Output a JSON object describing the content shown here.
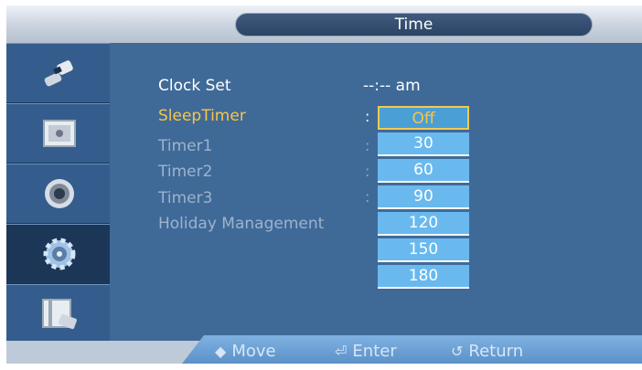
{
  "title": "Time",
  "sidebar": {
    "tabs": [
      {
        "icon": "input-plug-icon"
      },
      {
        "icon": "picture-icon"
      },
      {
        "icon": "sound-speaker-icon"
      },
      {
        "icon": "setup-gear-icon",
        "active": true
      },
      {
        "icon": "multi-control-icon"
      }
    ]
  },
  "menu": {
    "clock_set_label": "Clock Set",
    "clock_set_value": "--:-- am",
    "sleep_timer_label": "SleepTimer",
    "timer1_label": "Timer1",
    "timer2_label": "Timer2",
    "timer3_label": "Timer3",
    "holiday_label": "Holiday Management",
    "colon": ":"
  },
  "dropdown": {
    "options": [
      "Off",
      "30",
      "60",
      "90",
      "120",
      "150",
      "180"
    ],
    "selected": "Off"
  },
  "footer": {
    "move_label": "Move",
    "enter_label": "Enter",
    "return_label": "Return"
  },
  "colors": {
    "background": "#3f6a98",
    "highlight": "#f6c64a",
    "dropdown": "#69b9ef"
  }
}
